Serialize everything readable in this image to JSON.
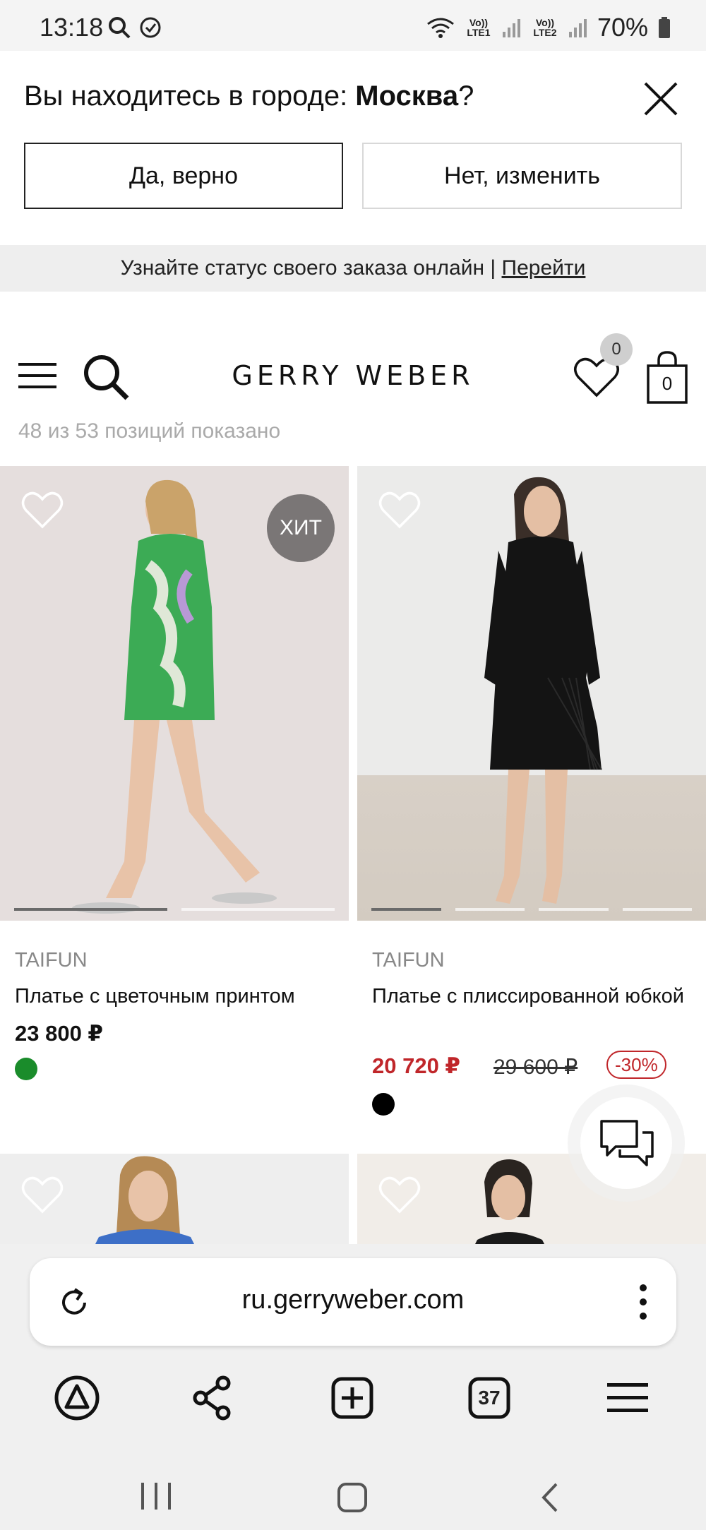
{
  "status_bar": {
    "time": "13:18",
    "net1": "Vo)) LTE1",
    "net2": "Vo)) LTE2",
    "battery": "70%"
  },
  "city_prompt": {
    "question_prefix": "Вы находитесь в городе: ",
    "city": "Москва",
    "question_suffix": "?",
    "yes_label": "Да, верно",
    "no_label": "Нет, изменить"
  },
  "order_bar": {
    "text": "Узнайте статус своего заказа онлайн | ",
    "link": "Перейти"
  },
  "header": {
    "logo": "GERRY WEBER",
    "favorites_count": "0",
    "cart_count": "0"
  },
  "listing": {
    "count_text": "48 из 53 позиций показано"
  },
  "products": [
    {
      "badge": "ХИТ",
      "brand": "TAIFUN",
      "name": "Платье с цветочным принтом",
      "price": "23 800 ₽",
      "swatch": "#1a8c2b",
      "gallery_index": 1,
      "gallery_total": 2
    },
    {
      "brand": "TAIFUN",
      "name": "Платье с плиссированной юбкой",
      "price": "20 720 ₽",
      "old_price": "29 600 ₽",
      "discount": "-30%",
      "swatch": "#000000",
      "gallery_index": 1,
      "gallery_total": 4
    }
  ],
  "browser": {
    "url": "ru.gerryweber.com",
    "tabs_count": "37"
  },
  "colors": {
    "sale_red": "#c0262a",
    "badge_gray": "#7a7676"
  }
}
